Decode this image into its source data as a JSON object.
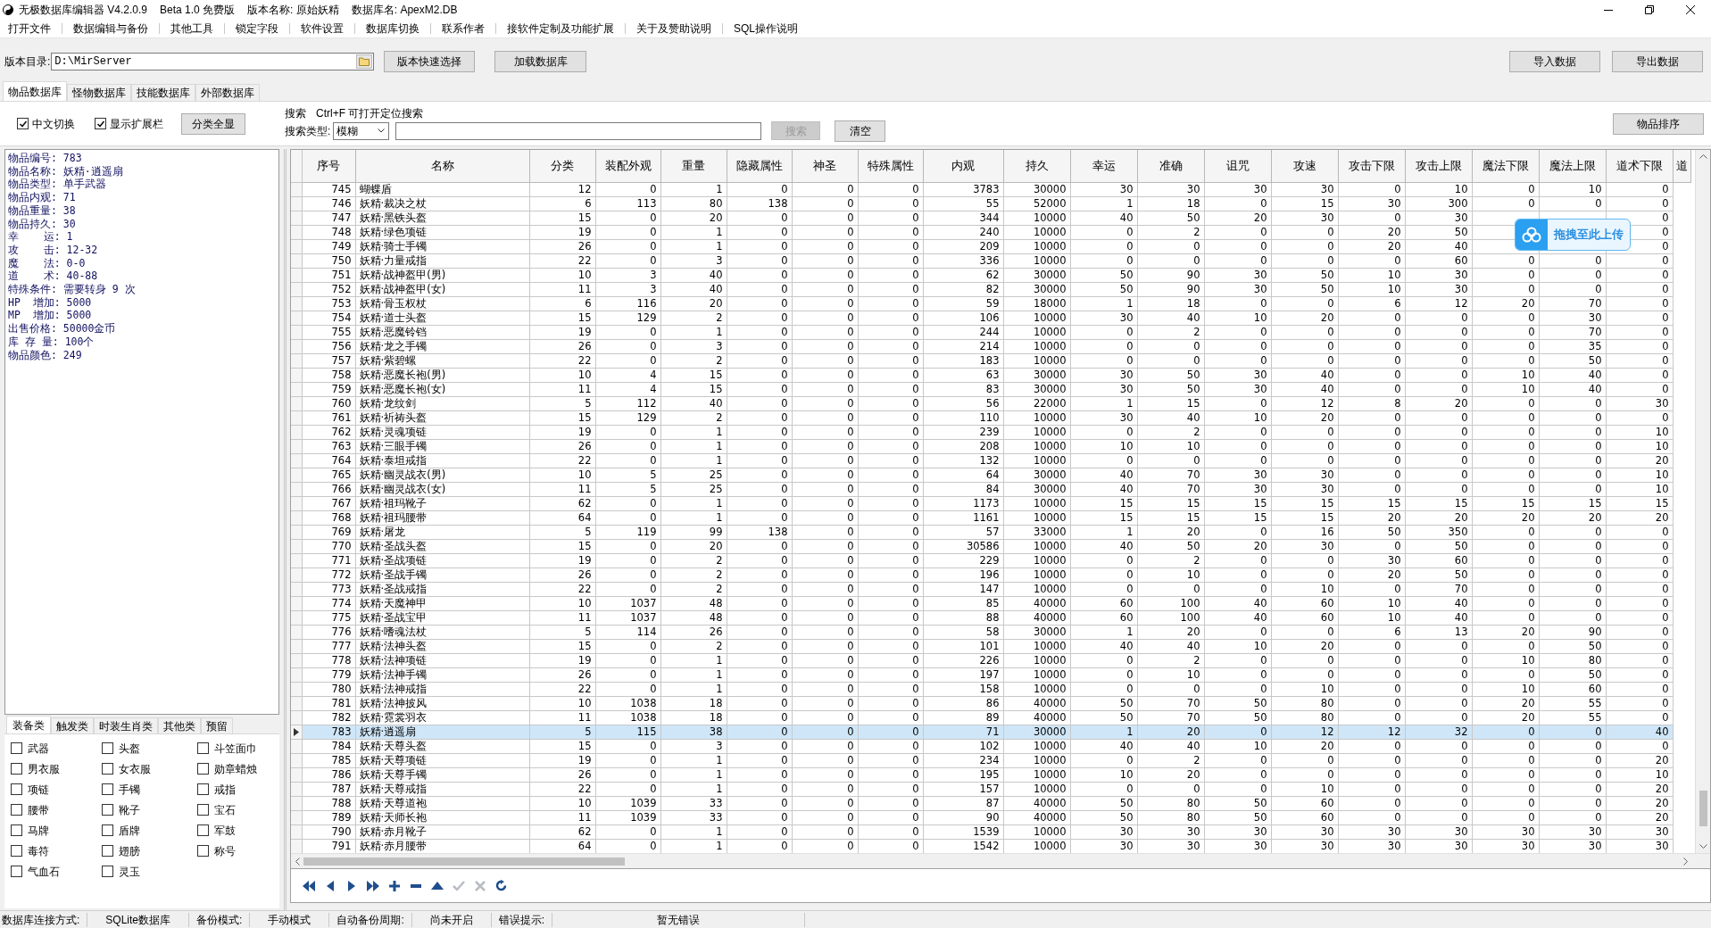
{
  "window": {
    "title": "无极数据库编辑器 V4.2.0.9",
    "edition": "Beta 1.0 免费版",
    "version_name": "版本名称: 原始妖精",
    "db_name": "数据库名: ApexM2.DB"
  },
  "menu": [
    "打开文件",
    "数据编辑与备份",
    "其他工具",
    "锁定字段",
    "软件设置",
    "数据库切换",
    "联系作者",
    "接软件定制及功能扩展",
    "关于及赞助说明",
    "SQL操作说明"
  ],
  "path": {
    "label": "版本目录:",
    "value": "D:\\MirServer"
  },
  "toolbar_buttons": [
    "版本快速选择",
    "加载数据库"
  ],
  "right_buttons": [
    "导入数据",
    "导出数据"
  ],
  "tabs": [
    {
      "label": "物品数据库",
      "selected": true
    },
    {
      "label": "怪物数据库",
      "selected": false
    },
    {
      "label": "技能数据库",
      "selected": false
    },
    {
      "label": "外部数据库",
      "selected": false
    }
  ],
  "options": [
    {
      "label": "中文切换",
      "checked": true
    },
    {
      "label": "显示扩展栏",
      "checked": true
    }
  ],
  "show_all_button": "分类全显",
  "search": {
    "title": "搜索",
    "hint": "Ctrl+F 可打开定位搜索",
    "type_label": "搜索类型:",
    "type_value": "模糊",
    "search_button": {
      "label": "搜索",
      "disabled": true
    },
    "clear_button": "清空"
  },
  "sort_button": "物品排序",
  "info_lines": [
    "物品编号: 783",
    "物品名称: 妖精·逍遥扇",
    "物品类型: 单手武器",
    "物品内观: 71",
    "物品重量: 38",
    "物品持久: 30",
    "幸    运: 1",
    "攻    击: 12-32",
    "魔    法: 0-0",
    "道    术: 40-88",
    "特殊条件: 需要转身 9 次",
    "HP  增加: 5000",
    "MP  增加: 5000",
    "出售价格: 50000金币",
    "库 存 量: 100个",
    "物品颜色: 249"
  ],
  "category_tabs": [
    {
      "label": "装备类",
      "selected": true
    },
    {
      "label": "触发类",
      "selected": false
    },
    {
      "label": "时装生肖类",
      "selected": false
    },
    {
      "label": "其他类",
      "selected": false
    },
    {
      "label": "预留",
      "selected": false
    }
  ],
  "categories": [
    {
      "label": "武器",
      "checked": false
    },
    {
      "label": "头盔",
      "checked": false
    },
    {
      "label": "斗笠面巾",
      "checked": false
    },
    {
      "label": "男衣服",
      "checked": false
    },
    {
      "label": "女衣服",
      "checked": false
    },
    {
      "label": "勋章蜡烛",
      "checked": false
    },
    {
      "label": "项链",
      "checked": false
    },
    {
      "label": "手镯",
      "checked": false
    },
    {
      "label": "戒指",
      "checked": false
    },
    {
      "label": "腰带",
      "checked": false
    },
    {
      "label": "靴子",
      "checked": false
    },
    {
      "label": "宝石",
      "checked": false
    },
    {
      "label": "马牌",
      "checked": false
    },
    {
      "label": "盾牌",
      "checked": false
    },
    {
      "label": "军鼓",
      "checked": false
    },
    {
      "label": "毒符",
      "checked": false
    },
    {
      "label": "翅膀",
      "checked": false
    },
    {
      "label": "称号",
      "checked": false
    },
    {
      "label": "气血石",
      "checked": false
    },
    {
      "label": "灵玉",
      "checked": false
    }
  ],
  "table": {
    "columns": [
      "序号",
      "名称",
      "分类",
      "装配外观",
      "重量",
      "隐藏属性",
      "神圣",
      "特殊属性",
      "内观",
      "持久",
      "幸运",
      "准确",
      "诅咒",
      "攻速",
      "攻击下限",
      "攻击上限",
      "魔法下限",
      "魔法上限",
      "道术下限",
      "道"
    ],
    "rows": [
      {
        "cells": [
          "745",
          "蝴蝶盾",
          "12",
          "0",
          "1",
          "0",
          "0",
          "0",
          "3783",
          "30000",
          "30",
          "30",
          "30",
          "30",
          "0",
          "10",
          "0",
          "10",
          "0"
        ],
        "selected": false
      },
      {
        "cells": [
          "746",
          "妖精·裁决之杖",
          "6",
          "113",
          "80",
          "138",
          "0",
          "0",
          "55",
          "52000",
          "1",
          "18",
          "0",
          "15",
          "30",
          "300",
          "0",
          "0",
          "0"
        ],
        "selected": false
      },
      {
        "cells": [
          "747",
          "妖精·黑铁头盔",
          "15",
          "0",
          "20",
          "0",
          "0",
          "0",
          "344",
          "10000",
          "40",
          "50",
          "20",
          "30",
          "0",
          "30",
          null,
          null,
          "0"
        ],
        "selected": false
      },
      {
        "cells": [
          "748",
          "妖精·绿色项链",
          "19",
          "0",
          "1",
          "0",
          "0",
          "0",
          "240",
          "10000",
          "0",
          "2",
          "0",
          "0",
          "20",
          "50",
          null,
          null,
          "0"
        ],
        "selected": false
      },
      {
        "cells": [
          "749",
          "妖精·骑士手镯",
          "26",
          "0",
          "1",
          "0",
          "0",
          "0",
          "209",
          "10000",
          "0",
          "0",
          "0",
          "0",
          "20",
          "40",
          null,
          null,
          "0"
        ],
        "selected": false
      },
      {
        "cells": [
          "750",
          "妖精·力量戒指",
          "22",
          "0",
          "3",
          "0",
          "0",
          "0",
          "336",
          "10000",
          "0",
          "0",
          "0",
          "0",
          "0",
          "60",
          "0",
          "0",
          "0"
        ],
        "selected": false
      },
      {
        "cells": [
          "751",
          "妖精·战神盔甲(男)",
          "10",
          "3",
          "40",
          "0",
          "0",
          "0",
          "62",
          "30000",
          "50",
          "90",
          "30",
          "50",
          "10",
          "30",
          "0",
          "0",
          "0"
        ],
        "selected": false
      },
      {
        "cells": [
          "752",
          "妖精·战神盔甲(女)",
          "11",
          "3",
          "40",
          "0",
          "0",
          "0",
          "82",
          "30000",
          "50",
          "90",
          "30",
          "50",
          "10",
          "30",
          "0",
          "0",
          "0"
        ],
        "selected": false
      },
      {
        "cells": [
          "753",
          "妖精·骨玉权杖",
          "6",
          "116",
          "20",
          "0",
          "0",
          "0",
          "59",
          "18000",
          "1",
          "18",
          "0",
          "0",
          "6",
          "12",
          "20",
          "70",
          "0"
        ],
        "selected": false
      },
      {
        "cells": [
          "754",
          "妖精·道士头盔",
          "15",
          "129",
          "2",
          "0",
          "0",
          "0",
          "106",
          "10000",
          "30",
          "40",
          "10",
          "20",
          "0",
          "0",
          "0",
          "30",
          "0"
        ],
        "selected": false
      },
      {
        "cells": [
          "755",
          "妖精·恶魔铃铛",
          "19",
          "0",
          "1",
          "0",
          "0",
          "0",
          "244",
          "10000",
          "0",
          "2",
          "0",
          "0",
          "0",
          "0",
          "0",
          "70",
          "0"
        ],
        "selected": false
      },
      {
        "cells": [
          "756",
          "妖精·龙之手镯",
          "26",
          "0",
          "3",
          "0",
          "0",
          "0",
          "214",
          "10000",
          "0",
          "0",
          "0",
          "0",
          "0",
          "0",
          "0",
          "35",
          "0"
        ],
        "selected": false
      },
      {
        "cells": [
          "757",
          "妖精·紫碧螺",
          "22",
          "0",
          "2",
          "0",
          "0",
          "0",
          "183",
          "10000",
          "0",
          "0",
          "0",
          "0",
          "0",
          "0",
          "0",
          "50",
          "0"
        ],
        "selected": false
      },
      {
        "cells": [
          "758",
          "妖精·恶魔长袍(男)",
          "10",
          "4",
          "15",
          "0",
          "0",
          "0",
          "63",
          "30000",
          "30",
          "50",
          "30",
          "40",
          "0",
          "0",
          "10",
          "40",
          "0"
        ],
        "selected": false
      },
      {
        "cells": [
          "759",
          "妖精·恶魔长袍(女)",
          "11",
          "4",
          "15",
          "0",
          "0",
          "0",
          "83",
          "30000",
          "30",
          "50",
          "30",
          "40",
          "0",
          "0",
          "10",
          "40",
          "0"
        ],
        "selected": false
      },
      {
        "cells": [
          "760",
          "妖精·龙纹剑",
          "5",
          "112",
          "40",
          "0",
          "0",
          "0",
          "56",
          "22000",
          "1",
          "15",
          "0",
          "12",
          "8",
          "20",
          "0",
          "0",
          "30"
        ],
        "selected": false
      },
      {
        "cells": [
          "761",
          "妖精·祈祷头盔",
          "15",
          "129",
          "2",
          "0",
          "0",
          "0",
          "110",
          "10000",
          "30",
          "40",
          "10",
          "20",
          "0",
          "0",
          "0",
          "0",
          "0"
        ],
        "selected": false
      },
      {
        "cells": [
          "762",
          "妖精·灵魂项链",
          "19",
          "0",
          "1",
          "0",
          "0",
          "0",
          "239",
          "10000",
          "0",
          "2",
          "0",
          "0",
          "0",
          "0",
          "0",
          "0",
          "10"
        ],
        "selected": false
      },
      {
        "cells": [
          "763",
          "妖精·三眼手镯",
          "26",
          "0",
          "1",
          "0",
          "0",
          "0",
          "208",
          "10000",
          "10",
          "10",
          "0",
          "0",
          "0",
          "0",
          "0",
          "0",
          "10"
        ],
        "selected": false
      },
      {
        "cells": [
          "764",
          "妖精·泰坦戒指",
          "22",
          "0",
          "1",
          "0",
          "0",
          "0",
          "132",
          "10000",
          "0",
          "0",
          "0",
          "0",
          "0",
          "0",
          "0",
          "0",
          "20"
        ],
        "selected": false
      },
      {
        "cells": [
          "765",
          "妖精·幽灵战衣(男)",
          "10",
          "5",
          "25",
          "0",
          "0",
          "0",
          "64",
          "30000",
          "40",
          "70",
          "30",
          "30",
          "0",
          "0",
          "0",
          "0",
          "10"
        ],
        "selected": false
      },
      {
        "cells": [
          "766",
          "妖精·幽灵战衣(女)",
          "11",
          "5",
          "25",
          "0",
          "0",
          "0",
          "84",
          "30000",
          "40",
          "70",
          "30",
          "30",
          "0",
          "0",
          "0",
          "0",
          "10"
        ],
        "selected": false
      },
      {
        "cells": [
          "767",
          "妖精·祖玛靴子",
          "62",
          "0",
          "1",
          "0",
          "0",
          "0",
          "1173",
          "10000",
          "15",
          "15",
          "15",
          "15",
          "15",
          "15",
          "15",
          "15",
          "15"
        ],
        "selected": false
      },
      {
        "cells": [
          "768",
          "妖精·祖玛腰带",
          "64",
          "0",
          "1",
          "0",
          "0",
          "0",
          "1161",
          "10000",
          "15",
          "15",
          "15",
          "15",
          "20",
          "20",
          "20",
          "20",
          "20"
        ],
        "selected": false
      },
      {
        "cells": [
          "769",
          "妖精·屠龙",
          "5",
          "119",
          "99",
          "138",
          "0",
          "0",
          "57",
          "33000",
          "1",
          "20",
          "0",
          "16",
          "50",
          "350",
          "0",
          "0",
          "0"
        ],
        "selected": false
      },
      {
        "cells": [
          "770",
          "妖精·圣战头盔",
          "15",
          "0",
          "20",
          "0",
          "0",
          "0",
          "30586",
          "10000",
          "40",
          "50",
          "20",
          "30",
          "0",
          "50",
          "0",
          "0",
          "0"
        ],
        "selected": false
      },
      {
        "cells": [
          "771",
          "妖精·圣战项链",
          "19",
          "0",
          "2",
          "0",
          "0",
          "0",
          "229",
          "10000",
          "0",
          "2",
          "0",
          "0",
          "30",
          "60",
          "0",
          "0",
          "0"
        ],
        "selected": false
      },
      {
        "cells": [
          "772",
          "妖精·圣战手镯",
          "26",
          "0",
          "2",
          "0",
          "0",
          "0",
          "196",
          "10000",
          "0",
          "10",
          "0",
          "0",
          "20",
          "50",
          "0",
          "0",
          "0"
        ],
        "selected": false
      },
      {
        "cells": [
          "773",
          "妖精·圣战戒指",
          "22",
          "0",
          "2",
          "0",
          "0",
          "0",
          "147",
          "10000",
          "0",
          "0",
          "0",
          "10",
          "0",
          "70",
          "0",
          "0",
          "0"
        ],
        "selected": false
      },
      {
        "cells": [
          "774",
          "妖精·天魔神甲",
          "10",
          "1037",
          "48",
          "0",
          "0",
          "0",
          "85",
          "40000",
          "60",
          "100",
          "40",
          "60",
          "10",
          "40",
          "0",
          "0",
          "0"
        ],
        "selected": false
      },
      {
        "cells": [
          "775",
          "妖精·圣战宝甲",
          "11",
          "1037",
          "48",
          "0",
          "0",
          "0",
          "88",
          "40000",
          "60",
          "100",
          "40",
          "60",
          "10",
          "40",
          "0",
          "0",
          "0"
        ],
        "selected": false
      },
      {
        "cells": [
          "776",
          "妖精·嗜魂法杖",
          "5",
          "114",
          "26",
          "0",
          "0",
          "0",
          "58",
          "30000",
          "1",
          "20",
          "0",
          "0",
          "6",
          "13",
          "20",
          "90",
          "0"
        ],
        "selected": false
      },
      {
        "cells": [
          "777",
          "妖精·法神头盔",
          "15",
          "0",
          "2",
          "0",
          "0",
          "0",
          "101",
          "10000",
          "40",
          "40",
          "10",
          "20",
          "0",
          "0",
          "0",
          "50",
          "0"
        ],
        "selected": false
      },
      {
        "cells": [
          "778",
          "妖精·法神项链",
          "19",
          "0",
          "1",
          "0",
          "0",
          "0",
          "226",
          "10000",
          "0",
          "2",
          "0",
          "0",
          "0",
          "0",
          "10",
          "80",
          "0"
        ],
        "selected": false
      },
      {
        "cells": [
          "779",
          "妖精·法神手镯",
          "26",
          "0",
          "1",
          "0",
          "0",
          "0",
          "197",
          "10000",
          "0",
          "10",
          "0",
          "0",
          "0",
          "0",
          "0",
          "50",
          "0"
        ],
        "selected": false
      },
      {
        "cells": [
          "780",
          "妖精·法神戒指",
          "22",
          "0",
          "1",
          "0",
          "0",
          "0",
          "158",
          "10000",
          "0",
          "0",
          "0",
          "10",
          "0",
          "0",
          "10",
          "60",
          "0"
        ],
        "selected": false
      },
      {
        "cells": [
          "781",
          "妖精·法神披风",
          "10",
          "1038",
          "18",
          "0",
          "0",
          "0",
          "86",
          "40000",
          "50",
          "70",
          "50",
          "80",
          "0",
          "0",
          "20",
          "55",
          "0"
        ],
        "selected": false
      },
      {
        "cells": [
          "782",
          "妖精·霓裳羽衣",
          "11",
          "1038",
          "18",
          "0",
          "0",
          "0",
          "89",
          "40000",
          "50",
          "70",
          "50",
          "80",
          "0",
          "0",
          "20",
          "55",
          "0"
        ],
        "selected": false
      },
      {
        "cells": [
          "783",
          "妖精·逍遥扇",
          "5",
          "115",
          "38",
          "0",
          "0",
          "0",
          "71",
          "30000",
          "1",
          "20",
          "0",
          "12",
          "12",
          "32",
          "0",
          "0",
          "40"
        ],
        "selected": true
      },
      {
        "cells": [
          "784",
          "妖精·天尊头盔",
          "15",
          "0",
          "3",
          "0",
          "0",
          "0",
          "102",
          "10000",
          "40",
          "40",
          "10",
          "20",
          "0",
          "0",
          "0",
          "0",
          "0"
        ],
        "selected": false
      },
      {
        "cells": [
          "785",
          "妖精·天尊项链",
          "19",
          "0",
          "1",
          "0",
          "0",
          "0",
          "234",
          "10000",
          "0",
          "2",
          "0",
          "0",
          "0",
          "0",
          "0",
          "0",
          "20"
        ],
        "selected": false
      },
      {
        "cells": [
          "786",
          "妖精·天尊手镯",
          "26",
          "0",
          "1",
          "0",
          "0",
          "0",
          "195",
          "10000",
          "10",
          "20",
          "0",
          "0",
          "0",
          "0",
          "0",
          "0",
          "10"
        ],
        "selected": false
      },
      {
        "cells": [
          "787",
          "妖精·天尊戒指",
          "22",
          "0",
          "1",
          "0",
          "0",
          "0",
          "157",
          "10000",
          "0",
          "0",
          "0",
          "10",
          "0",
          "0",
          "0",
          "0",
          "20"
        ],
        "selected": false
      },
      {
        "cells": [
          "788",
          "妖精·天尊道袍",
          "10",
          "1039",
          "33",
          "0",
          "0",
          "0",
          "87",
          "40000",
          "50",
          "80",
          "50",
          "60",
          "0",
          "0",
          "0",
          "0",
          "20"
        ],
        "selected": false
      },
      {
        "cells": [
          "789",
          "妖精·天师长袍",
          "11",
          "1039",
          "33",
          "0",
          "0",
          "0",
          "90",
          "40000",
          "50",
          "80",
          "50",
          "60",
          "0",
          "0",
          "0",
          "0",
          "20"
        ],
        "selected": false
      },
      {
        "cells": [
          "790",
          "妖精·赤月靴子",
          "62",
          "0",
          "1",
          "0",
          "0",
          "0",
          "1539",
          "10000",
          "30",
          "30",
          "30",
          "30",
          "30",
          "30",
          "30",
          "30",
          "30"
        ],
        "selected": false
      },
      {
        "cells": [
          "791",
          "妖精·赤月腰带",
          "64",
          "0",
          "1",
          "0",
          "0",
          "0",
          "1542",
          "10000",
          "30",
          "30",
          "30",
          "30",
          "30",
          "30",
          "30",
          "30",
          "30"
        ],
        "selected": false
      }
    ]
  },
  "nav_buttons": [
    {
      "kind": "first",
      "disabled": false
    },
    {
      "kind": "prev",
      "disabled": false
    },
    {
      "kind": "next",
      "disabled": false
    },
    {
      "kind": "last",
      "disabled": false
    },
    {
      "kind": "add",
      "disabled": false
    },
    {
      "kind": "delete",
      "disabled": false
    },
    {
      "kind": "edit",
      "disabled": false
    },
    {
      "kind": "post",
      "disabled": true
    },
    {
      "kind": "cancel",
      "disabled": true
    },
    {
      "kind": "refresh",
      "disabled": false
    }
  ],
  "upload_widget": {
    "label": "拖拽至此上传"
  },
  "status_bar": [
    {
      "label": "数据库连接方式:",
      "value": "SQLite数据库"
    },
    {
      "label": "备份模式:",
      "value": "手动模式"
    },
    {
      "label": "自动备份周期:",
      "value": "尚未开启"
    },
    {
      "label": "错误提示:",
      "value": "暂无错误"
    }
  ]
}
